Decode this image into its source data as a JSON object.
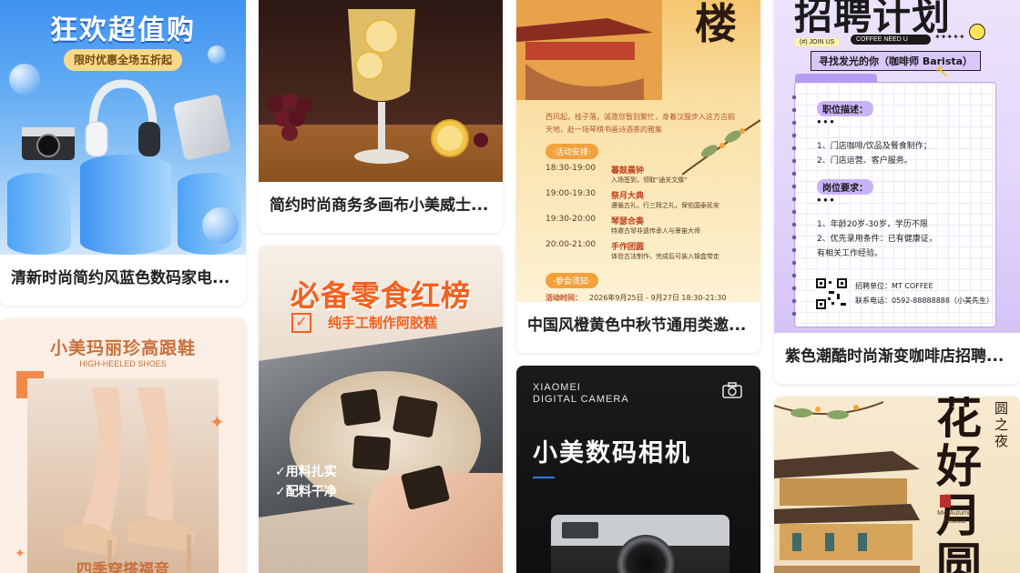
{
  "cards": [
    {
      "caption": "清新时尚简约风蓝色数码家电...",
      "poster": {
        "headline": "狂欢超值购",
        "banner": "限时优惠全场五折起",
        "colors": {
          "bg_top": "#3a8ff0",
          "bg_bottom": "#cfe6fb",
          "banner": "#f7d98a"
        }
      }
    },
    {
      "caption": "简约时尚商务多画布小美威士...",
      "poster": {
        "colors": {
          "bg": "#3a1f1a",
          "table": "#a0622e"
        }
      }
    },
    {
      "caption": "中国风橙黄色中秋节通用类邀...",
      "poster": {
        "title_char": "楼",
        "intro": "西风起，桂子落。诚邀您暂别繁忙，身着汉服步入这方古韵天地，赴一场琴棋书画诗酒茶的雅集",
        "section_schedule": "·活动安排·",
        "schedule": [
          {
            "time": "18:30-19:00",
            "title": "暮鼓晨钟",
            "desc": "入场签到，领取\"通关文牒\""
          },
          {
            "time": "19:00-19:30",
            "title": "祭月大典",
            "desc": "遵循古礼，行三拜之礼，保佑国泰民安"
          },
          {
            "time": "19:30-20:00",
            "title": "琴瑟合奏",
            "desc": "特邀古琴非遗传承人与箫笛大师"
          },
          {
            "time": "20:00-21:00",
            "title": "手作团圆",
            "desc": "体验古法制作，完成后可装入锦盒带走"
          }
        ],
        "section_notice": "·参会须知·",
        "event_time_label": "活动时间：",
        "event_time": "2026年9月25日 - 9月27日 18:30-21:30"
      }
    },
    {
      "caption": "紫色潮酷时尚渐变咖啡店招聘...",
      "poster": {
        "headline": "招聘计划",
        "tag_join": "(#) JOIN US",
        "tag_coffee": "COFFEE NEED U",
        "subtitle": "寻找发光的你（咖啡师 Barista）",
        "duty_label": "职位描述：",
        "duties": [
          "1、门店咖啡/饮品及餐食制作；",
          "2、门店运营、客户服务。"
        ],
        "req_label": "岗位要求：",
        "requirements": [
          "1、年龄20岁-30岁，学历不限",
          "2、优先录用条件：已有健康证，",
          "有相关工作经验。"
        ],
        "company": "招聘单位：MT COFFEE",
        "phone": "联系电话：0592-88888888（小美先生）"
      }
    },
    {
      "poster": {
        "title": "小美玛丽珍高跟鞋",
        "subtitle": "HIGH-HEELED SHOES",
        "footer": "四季穿搭福音"
      }
    },
    {
      "poster": {
        "title": "必备零食红榜",
        "subtitle": "纯手工制作阿胶糕",
        "check1": "用料扎实",
        "check2": "配料干净",
        "colors": {
          "title": "#f4601f"
        }
      }
    },
    {
      "poster": {
        "brand_line1": "XIAOMEI",
        "brand_line2": "DIGITAL CAMERA",
        "title": "小美数码相机",
        "camera_icon": "camera-icon"
      }
    },
    {
      "poster": {
        "calligraphy": "花好月圆",
        "side_text": "圆之夜",
        "festival": "Mid-Autumn Festival"
      }
    }
  ]
}
